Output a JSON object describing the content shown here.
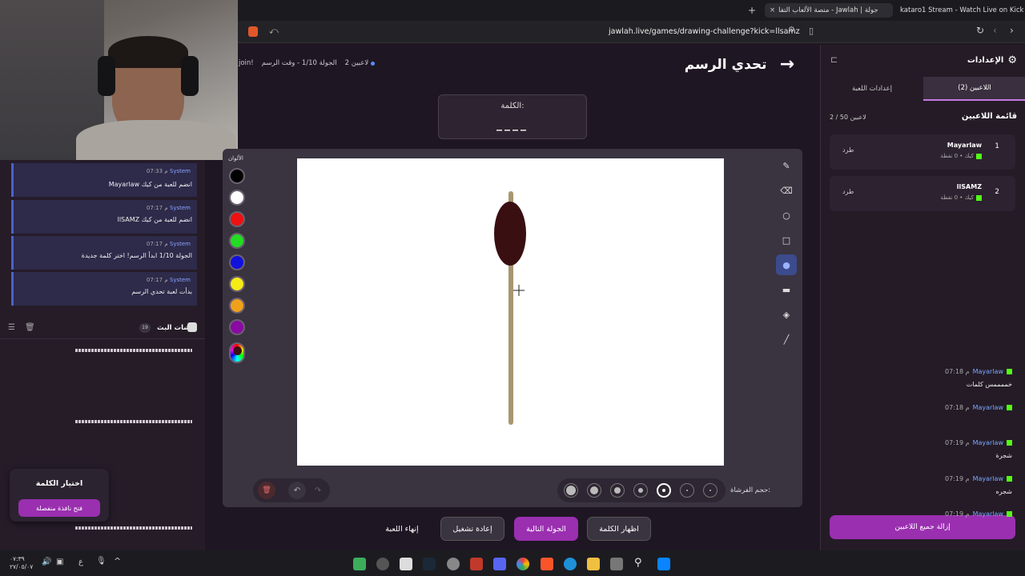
{
  "browser": {
    "tabs": [
      {
        "label": "جولة | Jawlah - منصة الألعاب التفا"
      },
      {
        "label": "kataro1 Stream - Watch Live on Kick"
      }
    ],
    "url": "jawlah.live/games/drawing-challenge?kick=llsamz",
    "new_tab": "+",
    "close_tab": "×"
  },
  "header": {
    "title": "تحدي الرسم",
    "players_count": "2 لاعبين",
    "round": "الجولة 1/10 - وقت الرسم",
    "join": "join!"
  },
  "word": {
    "label": "الكلمة:",
    "value": "____"
  },
  "palette": {
    "label": "الألوان",
    "colors": [
      "#000000",
      "#ffffff",
      "#ee1111",
      "#22dd22",
      "#1111dd",
      "#f5ec16",
      "#f0a11c",
      "#8a0aa3"
    ]
  },
  "brush": {
    "label": "حجم الفرشاة:",
    "color": "#3a0f12",
    "stick_color": "#a89670"
  },
  "controls": {
    "end_game": "إنهاء اللعبة",
    "restart": "إعادة تشغيل",
    "next_round": "الجولة التالية",
    "show_word": "اظهار الكلمة"
  },
  "settings": {
    "title": "الإعدادات",
    "tab_players": "اللاعبين (2)",
    "tab_game": "إعدادات اللعبة",
    "list_title": "قائمة اللاعبين",
    "capacity": "2 / 50 لاعبين",
    "players": [
      {
        "rank": "1",
        "name": "Mayarlaw",
        "meta": "كيك • 0 نقطة",
        "kick": "طرد"
      },
      {
        "rank": "2",
        "name": "llSAMZ",
        "meta": "كيك • 0 نقطة",
        "kick": "طرد"
      }
    ],
    "remove_all": "إزالة جميع اللاعبين"
  },
  "chat": {
    "system": [
      {
        "sender": "System",
        "time": "07:33 م",
        "text": "Mayarlaw انضم للعبة من كيك"
      },
      {
        "sender": "System",
        "time": "07:17 م",
        "text": "llSAMZ انضم للعبة من كيك"
      },
      {
        "sender": "System",
        "time": "07:17 م",
        "text": "الجولة 1/10 ابدأ الرسم! اختر كلمة جديدة"
      },
      {
        "sender": "System",
        "time": "07:17 م",
        "text": "بدأت لعبة تحدي الرسم"
      }
    ],
    "title": "شات البث",
    "count": "19",
    "messages": [
      {
        "sender": "Mayarlaw",
        "time": "07:18 م",
        "text": "خممممس كلمات"
      },
      {
        "sender": "Mayarlaw",
        "time": "07:18 م",
        "text": ""
      },
      {
        "sender": "Mayarlaw",
        "time": "07:19 م",
        "text": "شجرة"
      },
      {
        "sender": "Mayarlaw",
        "time": "07:19 م",
        "text": "شجره"
      },
      {
        "sender": "Mayarlaw",
        "time": "07:19 م",
        "text": ""
      }
    ]
  },
  "word_picker": {
    "title": "اختيار الكلمة",
    "open_window": "فتح نافذة منفصلة"
  },
  "taskbar": {
    "time": "٠٧:٣٩",
    "date": "٢٧/٠٥/٠٧",
    "lang": "ع"
  }
}
